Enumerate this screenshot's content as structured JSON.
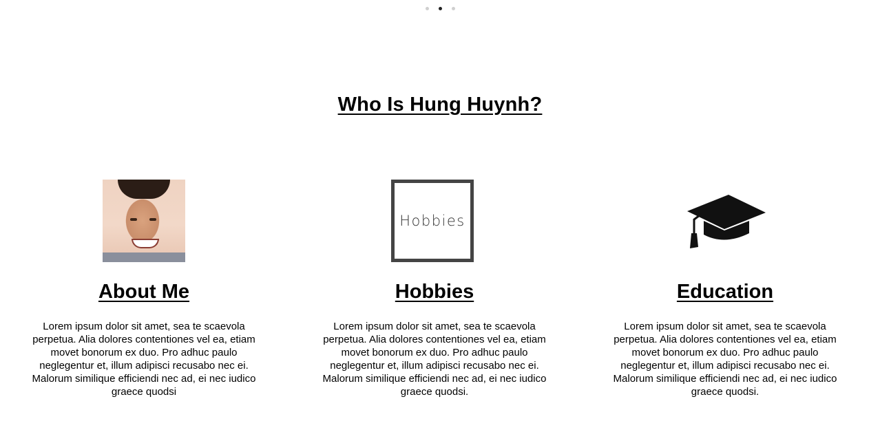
{
  "carousel": {
    "dots": [
      {
        "label": "slide-1",
        "active": false
      },
      {
        "label": "slide-2",
        "active": true
      },
      {
        "label": "slide-3",
        "active": false
      }
    ]
  },
  "section": {
    "title": "Who Is Hung Huynh?"
  },
  "columns": [
    {
      "heading": "About Me",
      "image": "profile-photo",
      "text": "Lorem ipsum dolor sit amet, sea te scaevola perpetua. Alia dolores contentiones vel ea, etiam movet bonorum ex duo. Pro adhuc paulo neglegentur et, illum adipisci recusabo nec ei. Malorum similique efficiendi nec ad, ei nec iudico graece quodsi"
    },
    {
      "heading": "Hobbies",
      "image_text": "Hobbies",
      "text": "Lorem ipsum dolor sit amet, sea te scaevola perpetua. Alia dolores contentiones vel ea, etiam movet bonorum ex duo. Pro adhuc paulo neglegentur et, illum adipisci recusabo nec ei. Malorum similique efficiendi nec ad, ei nec iudico graece quodsi."
    },
    {
      "heading": "Education",
      "icon": "graduation-cap-icon",
      "text": "Lorem ipsum dolor sit amet, sea te scaevola perpetua. Alia dolores contentiones vel ea, etiam movet bonorum ex duo. Pro adhuc paulo neglegentur et, illum adipisci recusabo nec ei. Malorum similique efficiendi nec ad, ei nec iudico graece quodsi."
    }
  ]
}
